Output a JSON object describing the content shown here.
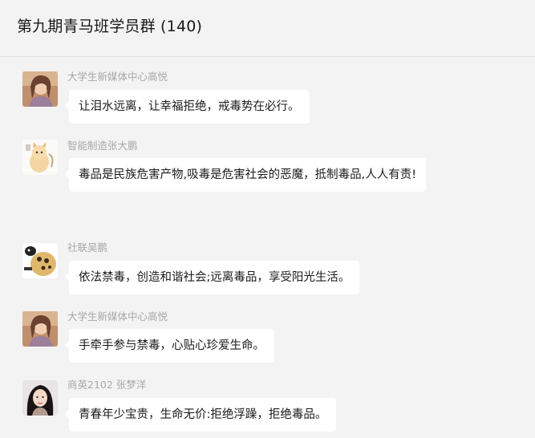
{
  "header": {
    "title": "第九期青马班学员群 (140)"
  },
  "messages": [
    {
      "sender": "大学生新媒体中心高悦",
      "text": "让泪水远离，让幸福拒绝，戒毒势在必行。",
      "avatar": "woman-photo-avatar"
    },
    {
      "sender": "智能制造张大鹏",
      "text": "毒品是民族危害产物,吸毒是危害社会的恶魔，抵制毒品,人人有责!",
      "avatar": "cartoon-cat-avatar"
    },
    {
      "sender": "社联吴鹏",
      "text": "依法禁毒，创造和谐社会;远离毒品，享受阳光生活。",
      "avatar": "cartoon-dog-avatar"
    },
    {
      "sender": "大学生新媒体中心高悦",
      "text": "手牵手参与禁毒，心贴心珍爱生命。",
      "avatar": "woman-photo-avatar"
    },
    {
      "sender": "商英2102 张梦洋",
      "text": "青春年少宝贵，生命无价:拒绝浮躁，拒绝毒品。",
      "avatar": "girl-photo-avatar"
    }
  ]
}
